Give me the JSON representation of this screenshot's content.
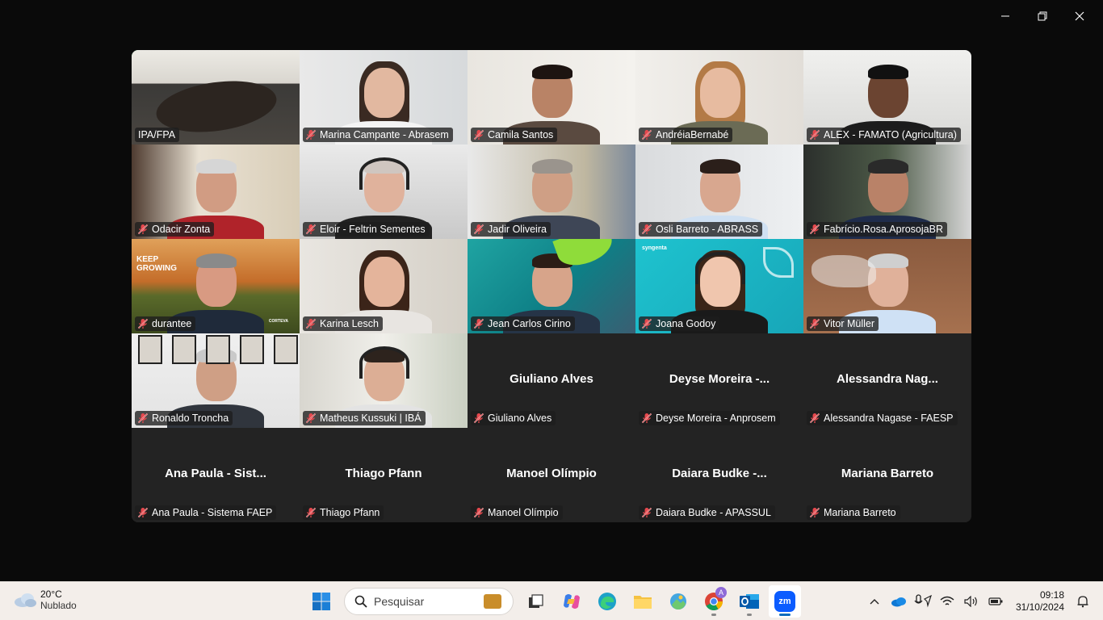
{
  "window": {
    "controls": [
      "minimize",
      "restore",
      "close"
    ]
  },
  "gallery": {
    "tiles": [
      {
        "name": "IPA/FPA",
        "muted": false,
        "active": true,
        "video": true
      },
      {
        "name": "Marina Campante - Abrasem",
        "muted": true,
        "video": true
      },
      {
        "name": "Camila Santos",
        "muted": true,
        "video": true
      },
      {
        "name": "AndréiaBernabé",
        "muted": true,
        "video": true
      },
      {
        "name": "ALEX - FAMATO (Agricultura)",
        "muted": true,
        "video": true
      },
      {
        "name": "Odacir Zonta",
        "muted": true,
        "video": true
      },
      {
        "name": "Eloir - Feltrin Sementes",
        "muted": true,
        "video": true
      },
      {
        "name": "Jadir Oliveira",
        "muted": true,
        "video": true
      },
      {
        "name": "Osli Barreto - ABRASS",
        "muted": true,
        "video": true
      },
      {
        "name": "Fabrício.Rosa.AprosojaBR",
        "muted": true,
        "video": true
      },
      {
        "name": "durantee",
        "muted": true,
        "video": true
      },
      {
        "name": "Karina Lesch",
        "muted": true,
        "video": true
      },
      {
        "name": "Jean Carlos Cirino",
        "muted": true,
        "video": true
      },
      {
        "name": "Joana Godoy",
        "muted": true,
        "video": true
      },
      {
        "name": "Vitor Müller",
        "muted": true,
        "video": true
      },
      {
        "name": "Ronaldo Troncha",
        "muted": true,
        "video": true
      },
      {
        "name": "Matheus Kussuki | IBÁ",
        "muted": true,
        "video": true
      },
      {
        "name": "Giuliano Alves",
        "display": "Giuliano Alves",
        "muted": true,
        "video": false
      },
      {
        "name": "Deyse Moreira - Anprosem",
        "display": "Deyse  Moreira -...",
        "muted": true,
        "video": false
      },
      {
        "name": "Alessandra Nagase - FAESP",
        "display": "Alessandra  Nag...",
        "muted": true,
        "video": false
      },
      {
        "name": "Ana Paula - Sistema FAEP",
        "display": "Ana Paula - Sist...",
        "muted": true,
        "video": false
      },
      {
        "name": "Thiago Pfann",
        "display": "Thiago Pfann",
        "muted": true,
        "video": false
      },
      {
        "name": "Manoel Olímpio",
        "display": "Manoel Olímpio",
        "muted": true,
        "video": false
      },
      {
        "name": "Daiara Budke - APASSUL",
        "display": "Daiara Budke -...",
        "muted": true,
        "video": false
      },
      {
        "name": "Mariana Barreto",
        "display": "Mariana Barreto",
        "muted": true,
        "video": false
      }
    ]
  },
  "backgrounds": {
    "durantee": {
      "line1": "KEEP",
      "line2": "GROWING",
      "brand": "CORTEVA"
    },
    "joana": {
      "brand": "syngenta"
    }
  },
  "taskbar": {
    "weather": {
      "temp": "20°C",
      "condition": "Nublado"
    },
    "search_placeholder": "Pesquisar",
    "apps": [
      "start-icon",
      "widgets-icon",
      "task-view-icon",
      "copilot-icon",
      "edge-icon",
      "file-explorer-icon",
      "photos-icon",
      "chrome-icon",
      "outlook-icon",
      "zoom-icon"
    ],
    "chrome_badge": "A",
    "zoom_label": "zm",
    "clock": {
      "time": "09:18",
      "date": "31/10/2024"
    }
  },
  "colors": {
    "active_border": "#2ecc71",
    "mic_off": "#e5484d",
    "tile_bg": "#232323"
  }
}
